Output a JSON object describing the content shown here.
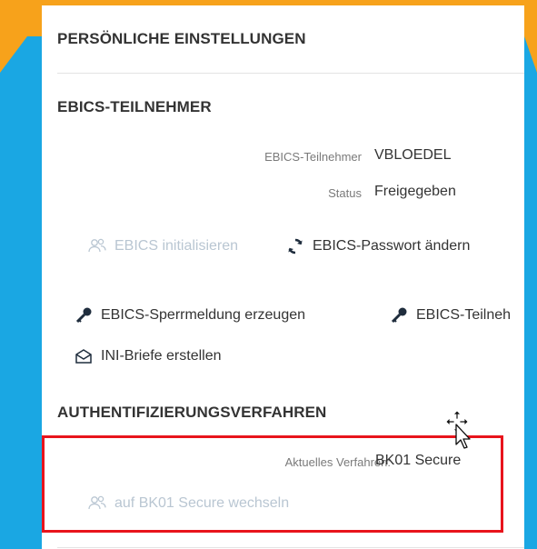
{
  "page": {
    "colors": {
      "background_blue": "#1aa7e3",
      "background_orange": "#f7a21b",
      "highlight_red": "#e8141c",
      "disabled_text": "#b9c6d2"
    }
  },
  "personal_settings": {
    "title": "PERSÖNLICHE EINSTELLUNGEN"
  },
  "ebics": {
    "title": "EBICS-TEILNEHMER",
    "participant_label": "EBICS-Teilnehmer",
    "participant_value": "VBLOEDEL",
    "status_label": "Status",
    "status_value": "Freigegeben",
    "actions": {
      "initialize": {
        "label": "EBICS initialisieren",
        "icon": "users-icon",
        "enabled": false
      },
      "change_password": {
        "label": "EBICS-Passwort ändern",
        "icon": "refresh-icon",
        "enabled": true
      },
      "lock_message": {
        "label": "EBICS-Sperrmeldung erzeugen",
        "icon": "key-icon",
        "enabled": true
      },
      "participant_truncated": {
        "label": "EBICS-Teilneh",
        "icon": "key-icon",
        "enabled": true
      },
      "ini_letters": {
        "label": "INI-Briefe erstellen",
        "icon": "envelope-icon",
        "enabled": true
      }
    }
  },
  "auth": {
    "title": "AUTHENTIFIZIERUNGSVERFAHREN",
    "current_label": "Aktuelles Verfahren:",
    "current_value": "BK01 Secure",
    "switch_action": {
      "label": "auf BK01 Secure wechseln",
      "icon": "users-icon",
      "enabled": false
    }
  }
}
